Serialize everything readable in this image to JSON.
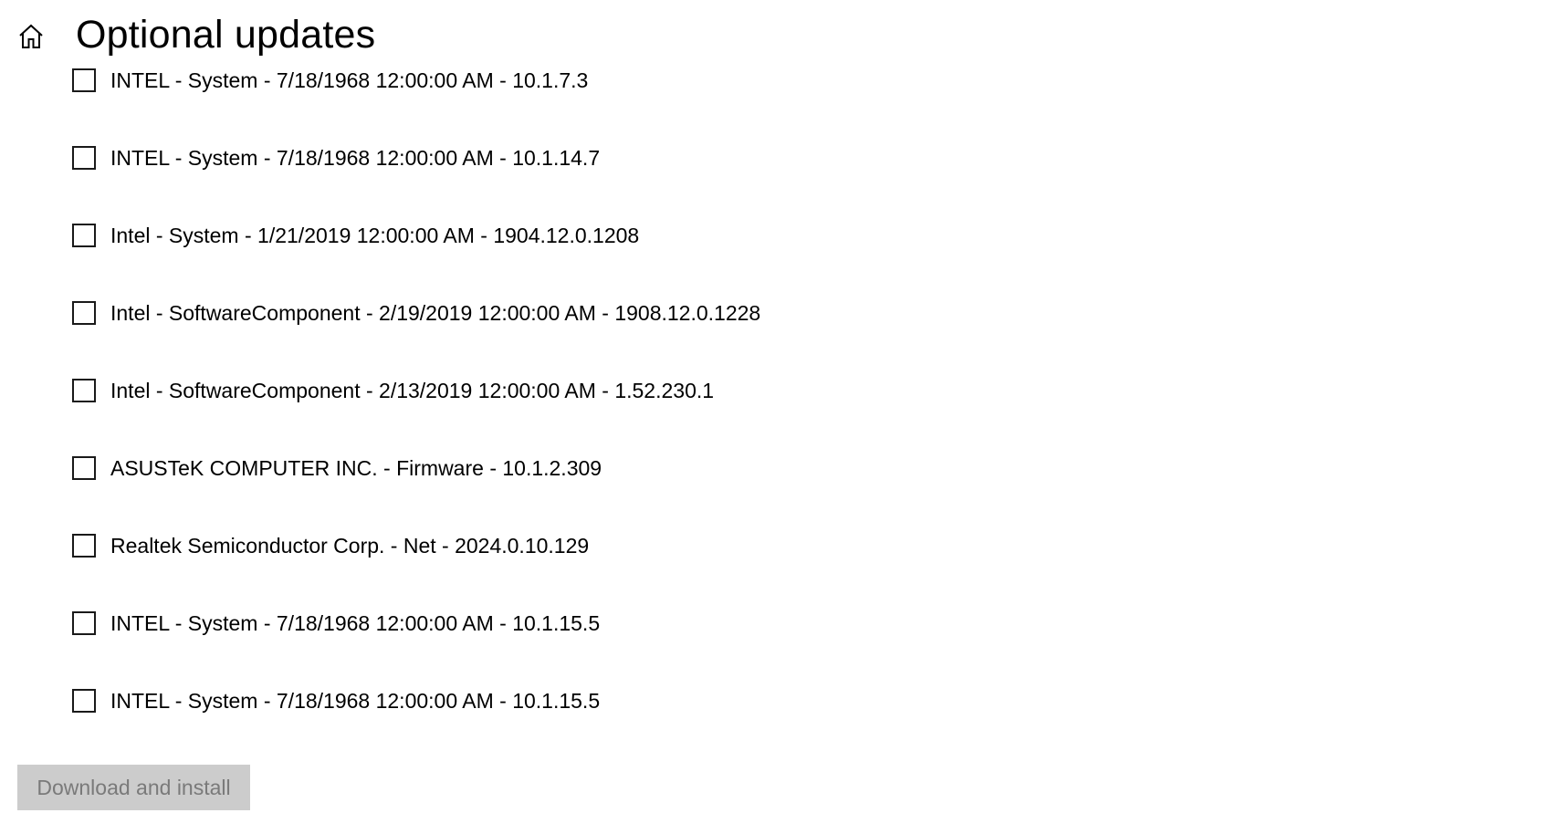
{
  "header": {
    "home_icon": "home-icon",
    "title": "Optional updates"
  },
  "updates": [
    {
      "label": "INTEL - System - 7/18/1968 12:00:00 AM - 10.1.7.3",
      "checked": false
    },
    {
      "label": "INTEL - System - 7/18/1968 12:00:00 AM - 10.1.14.7",
      "checked": false
    },
    {
      "label": "Intel - System - 1/21/2019 12:00:00 AM - 1904.12.0.1208",
      "checked": false
    },
    {
      "label": "Intel - SoftwareComponent - 2/19/2019 12:00:00 AM - 1908.12.0.1228",
      "checked": false
    },
    {
      "label": "Intel - SoftwareComponent - 2/13/2019 12:00:00 AM - 1.52.230.1",
      "checked": false
    },
    {
      "label": "ASUSTeK COMPUTER INC. - Firmware - 10.1.2.309",
      "checked": false
    },
    {
      "label": "Realtek Semiconductor Corp. - Net - 2024.0.10.129",
      "checked": false
    },
    {
      "label": "INTEL - System - 7/18/1968 12:00:00 AM - 10.1.15.5",
      "checked": false
    },
    {
      "label": "INTEL - System - 7/18/1968 12:00:00 AM - 10.1.15.5",
      "checked": false
    }
  ],
  "actions": {
    "install_label": "Download and install",
    "install_enabled": false
  },
  "colors": {
    "background": "#ffffff",
    "text": "#000000",
    "checkbox_border": "#1a1a1a",
    "button_disabled_bg": "#cccccc",
    "button_disabled_text": "#7a7a7a"
  }
}
